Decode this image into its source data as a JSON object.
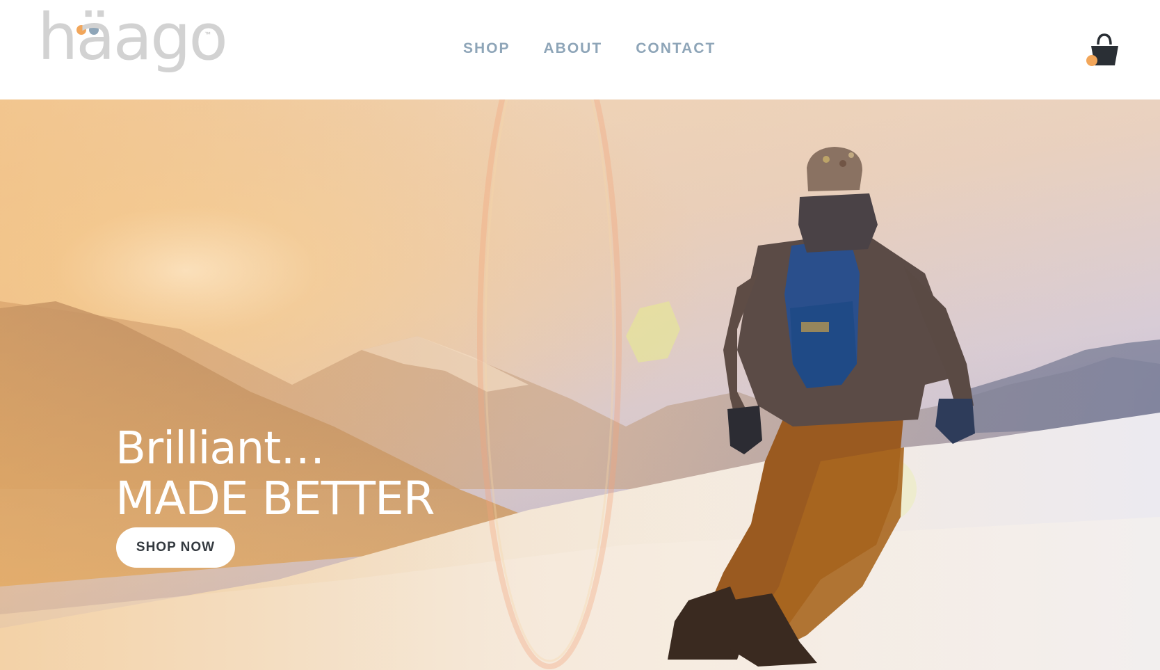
{
  "brand": {
    "logo_text": "häago",
    "trademark": "™",
    "dot_colors": [
      "#f2a65a",
      "#8ea5b8"
    ]
  },
  "nav": {
    "items": [
      {
        "label": "SHOP"
      },
      {
        "label": "ABOUT"
      },
      {
        "label": "CONTACT"
      }
    ]
  },
  "cart": {
    "icon": "shopping-bag-icon",
    "badge_color": "#f2a65a"
  },
  "hero": {
    "headline_line1": "Brilliant…",
    "headline_line2": "MADE BETTER",
    "cta_label": "SHOP NOW"
  },
  "colors": {
    "nav_text": "#8ea5b8",
    "logo_gray": "#d2d2d2",
    "accent_orange": "#f2a65a",
    "cta_text": "#33393f"
  }
}
